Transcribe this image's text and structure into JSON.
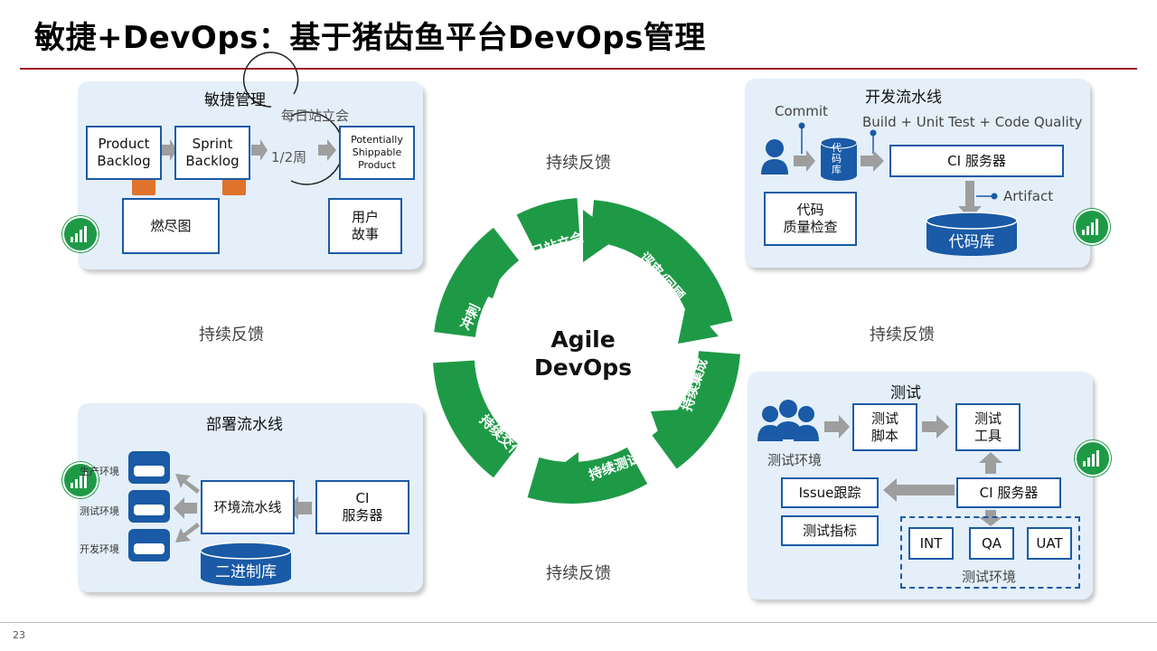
{
  "slide": {
    "title": "敏捷+DevOps：基于猪齿鱼平台DevOps管理",
    "page_number": "23",
    "feedback_label": "持续反馈"
  },
  "center": {
    "line1": "Agile",
    "line2": "DevOps",
    "cycle": [
      "每日站立会",
      "评审/回顾",
      "持续集成",
      "持续测试",
      "持续交付",
      "冲刺"
    ],
    "ring_color": "#1e9a47"
  },
  "agile": {
    "title": "敏捷管理",
    "product_backlog": "Product\nBacklog",
    "sprint_backlog": "Sprint\nBacklog",
    "daily_standup": "每日站立会",
    "cycle": "1/2周",
    "shippable": "Potentially\nShippable\nProduct",
    "burndown": "燃尽图",
    "user_story": "用户\n故事"
  },
  "dev": {
    "title": "开发流水线",
    "commit": "Commit",
    "build": "Build + Unit Test + Code Quality",
    "repo_small": "代\n码\n库",
    "ci_server": "CI 服务器",
    "artifact": "Artifact",
    "quality": "代码\n质量检查",
    "repo": "代码库"
  },
  "deploy": {
    "title": "部署流水线",
    "env_prod": "生产环境",
    "env_test": "测试环境",
    "env_dev": "开发环境",
    "pipeline": "环境流水线",
    "ci_server": "CI\n服务器",
    "binary_repo": "二进制库"
  },
  "test": {
    "title": "测试",
    "test_env": "测试环境",
    "script": "测试\n脚本",
    "tool": "测试\n工具",
    "issue": "Issue跟踪",
    "ci_server": "CI 服务器",
    "metrics": "测试指标",
    "int": "INT",
    "qa": "QA",
    "uat": "UAT",
    "test_env2": "测试环境"
  }
}
